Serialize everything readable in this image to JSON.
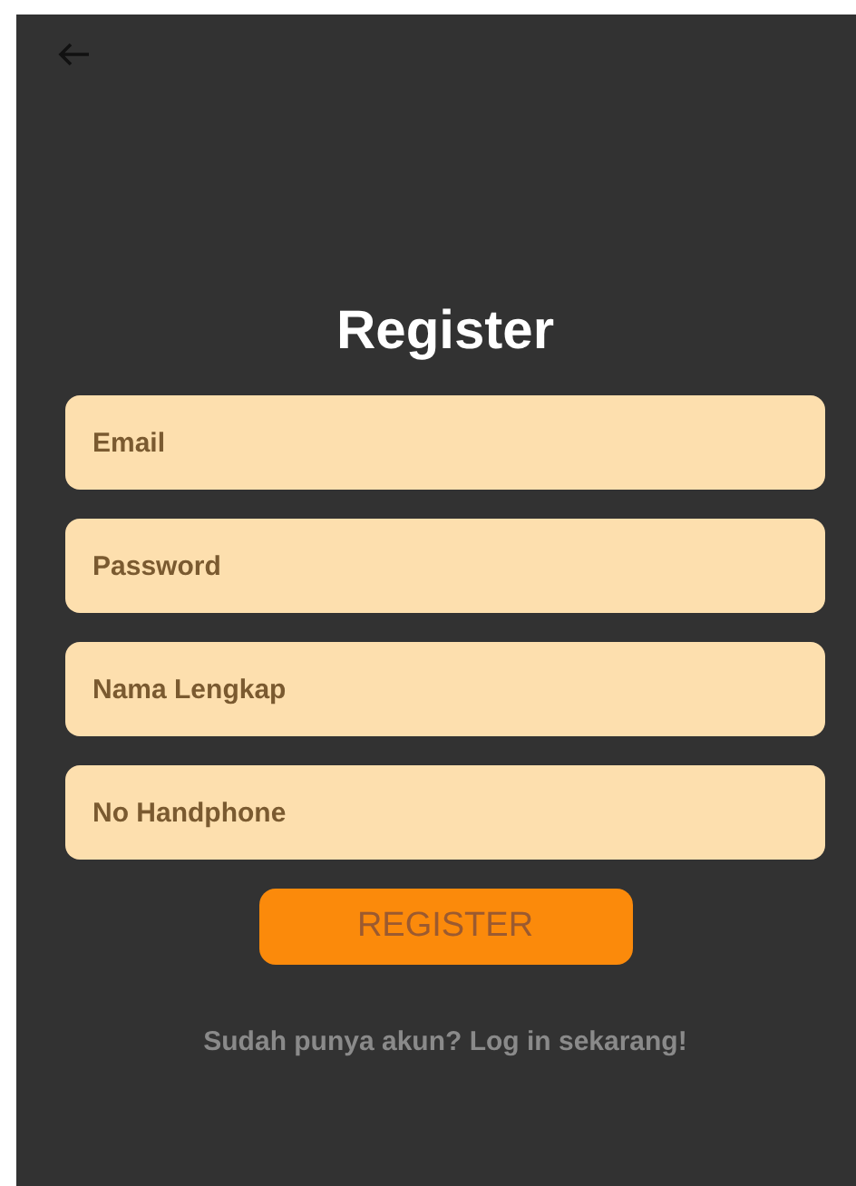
{
  "title": "Register",
  "fields": [
    {
      "placeholder": "Email"
    },
    {
      "placeholder": "Password"
    },
    {
      "placeholder": "Nama Lengkap"
    },
    {
      "placeholder": "No Handphone"
    }
  ],
  "button": "REGISTER",
  "login_link": "Sudah punya akun? Log in sekarang!"
}
